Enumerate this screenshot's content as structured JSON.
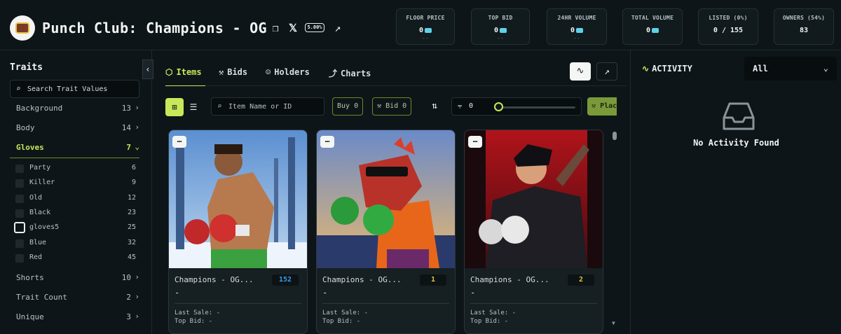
{
  "header": {
    "title": "Punch Club: Champions - OG",
    "fee_badge": "5.00%",
    "icons": [
      "copy-icon",
      "x-logo-icon",
      "external-link-icon"
    ],
    "stats": [
      {
        "label": "FLOOR PRICE",
        "value": "0",
        "sub": "--"
      },
      {
        "label": "TOP BID",
        "value": "0",
        "sub": "--"
      },
      {
        "label": "24HR VOLUME",
        "value": "0",
        "sub": "--"
      },
      {
        "label": "TOTAL VOLUME",
        "value": "0"
      },
      {
        "label": "LISTED (0%)",
        "value": "0 / 155"
      },
      {
        "label": "OWNERS (54%)",
        "value": "83"
      }
    ]
  },
  "sidebar": {
    "title": "Traits",
    "search_placeholder": "Search Trait Values",
    "traits": [
      {
        "name": "Background",
        "count": "13"
      },
      {
        "name": "Body",
        "count": "14"
      },
      {
        "name": "Gloves",
        "count": "7"
      }
    ],
    "gloves_options": [
      {
        "name": "Party",
        "count": "6"
      },
      {
        "name": "Killer",
        "count": "9"
      },
      {
        "name": "Old",
        "count": "12"
      },
      {
        "name": "Black",
        "count": "23"
      },
      {
        "name": "gloves5",
        "count": "25"
      },
      {
        "name": "Blue",
        "count": "32"
      },
      {
        "name": "Red",
        "count": "45"
      }
    ],
    "traits_after": [
      {
        "name": "Shorts",
        "count": "10"
      },
      {
        "name": "Trait Count",
        "count": "2"
      },
      {
        "name": "Unique",
        "count": "3"
      }
    ]
  },
  "tabs": [
    {
      "label": "Items",
      "icon": "layers-icon"
    },
    {
      "label": "Bids",
      "icon": "gavel-icon"
    },
    {
      "label": "Holders",
      "icon": "users-icon"
    },
    {
      "label": "Charts",
      "icon": "line-chart-icon"
    }
  ],
  "toolbar": {
    "search_placeholder": "Item Name or ID",
    "buy_label": "Buy 0",
    "bid_label": "Bid 0",
    "sweep_value": "0",
    "sweep_level": 0,
    "place_label": "Place"
  },
  "items": [
    {
      "name": "Champions - OG...",
      "price": "-",
      "number": "152",
      "badge_color": "#3a9bf0",
      "last_sale": "Last Sale: -",
      "top_bid": "Top Bid: -"
    },
    {
      "name": "Champions - OG...",
      "price": "-",
      "number": "1",
      "badge_color": "#e8c23a",
      "last_sale": "Last Sale: -",
      "top_bid": "Top Bid: -"
    },
    {
      "name": "Champions - OG...",
      "price": "-",
      "number": "2",
      "badge_color": "#e8c23a",
      "last_sale": "Last Sale: -",
      "top_bid": "Top Bid: -"
    }
  ],
  "activity": {
    "title": "ACTIVITY",
    "filter": "All",
    "empty_text": "No Activity Found"
  },
  "colors": {
    "accent": "#c8e85a",
    "background": "#0e1518"
  }
}
